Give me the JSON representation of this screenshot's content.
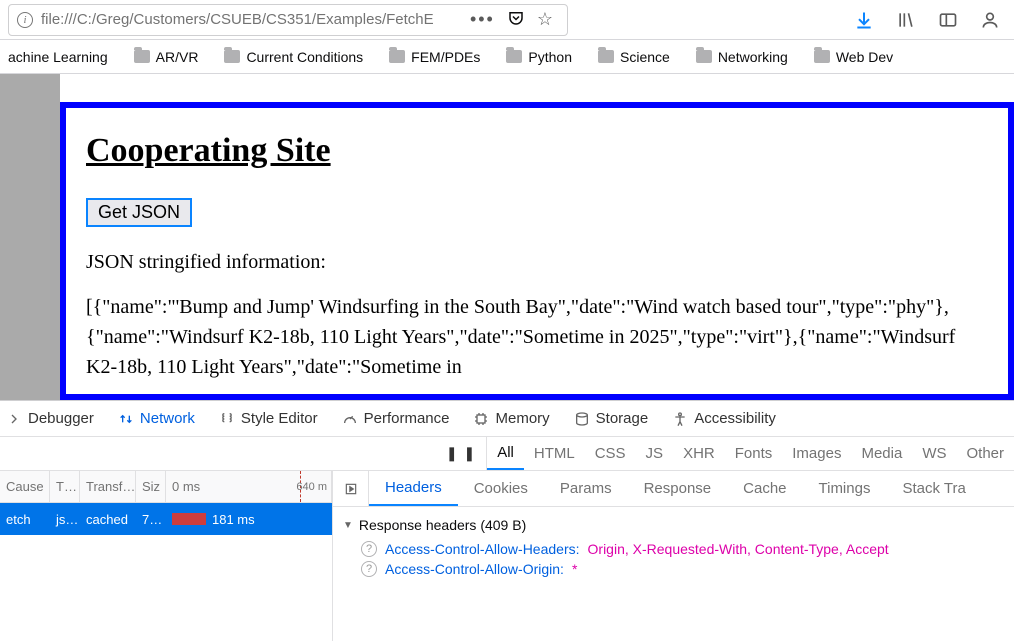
{
  "url": "file:///C:/Greg/Customers/CSUEB/CS351/Examples/FetchE",
  "bookmarks": [
    {
      "label": "achine Learning"
    },
    {
      "label": "AR/VR"
    },
    {
      "label": "Current Conditions"
    },
    {
      "label": "FEM/PDEs"
    },
    {
      "label": "Python"
    },
    {
      "label": "Science"
    },
    {
      "label": "Networking"
    },
    {
      "label": "Web Dev"
    }
  ],
  "page": {
    "title": "Cooperating Site",
    "button_label": "Get JSON",
    "subhead": "JSON stringified information:",
    "json_dump": "[{\"name\":\"'Bump and Jump' Windsurfing in the South Bay\",\"date\":\"Wind watch based tour\",\"type\":\"phy\"},{\"name\":\"Windsurf K2-18b, 110 Light Years\",\"date\":\"Sometime in 2025\",\"type\":\"virt\"},{\"name\":\"Windsurf K2-18b, 110 Light Years\",\"date\":\"Sometime in"
  },
  "devtools": {
    "panels": {
      "debugger": "Debugger",
      "network": "Network",
      "style": "Style Editor",
      "performance": "Performance",
      "memory": "Memory",
      "storage": "Storage",
      "accessibility": "Accessibility"
    },
    "filters": {
      "all": "All",
      "html": "HTML",
      "css": "CSS",
      "js": "JS",
      "xhr": "XHR",
      "fonts": "Fonts",
      "images": "Images",
      "media": "Media",
      "ws": "WS",
      "other": "Other"
    },
    "net_table": {
      "columns": {
        "cause": "Cause",
        "type": "T…",
        "transferred": "Transf…",
        "size": "Siz",
        "waterfall_zero": "0 ms",
        "waterfall_mark": "640 m"
      },
      "row": {
        "cause": "etch",
        "type": "js…",
        "transferred": "cached",
        "size": "7…",
        "timing": "181 ms"
      }
    },
    "details": {
      "tabs": {
        "headers": "Headers",
        "cookies": "Cookies",
        "params": "Params",
        "response": "Response",
        "cache": "Cache",
        "timings": "Timings",
        "stack": "Stack Tra"
      },
      "section": "Response headers (409 B)",
      "hdr1_name": "Access-Control-Allow-Headers:",
      "hdr1_val": "Origin, X-Requested-With, Content-Type, Accept",
      "hdr2_name": "Access-Control-Allow-Origin:",
      "hdr2_val": "*"
    }
  }
}
